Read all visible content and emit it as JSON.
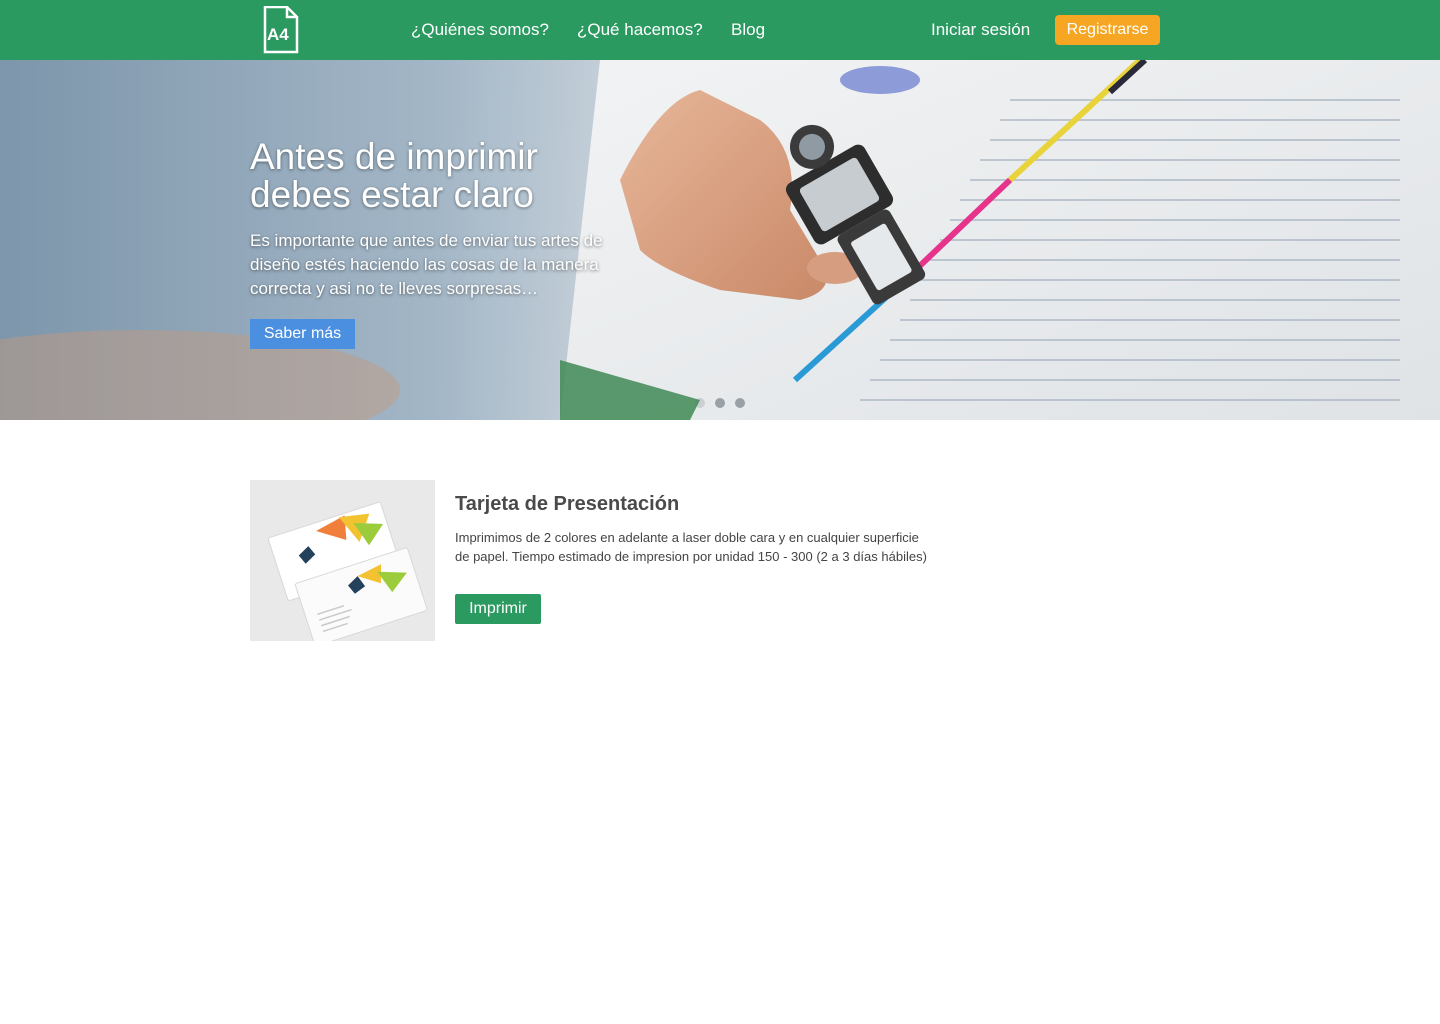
{
  "colors": {
    "nav_background": "#2b9a61",
    "register_button": "#f6a623",
    "hero_button": "#4a8fe0",
    "print_button": "#2b9a61"
  },
  "header": {
    "logo_text": "A4",
    "nav": {
      "quienes": "¿Quiénes somos?",
      "que_hacemos": "¿Qué hacemos?",
      "blog": "Blog"
    },
    "login_label": "Iniciar sesión",
    "register_label": "Registrarse"
  },
  "hero": {
    "title_line1": "Antes de imprimir",
    "title_line2": "debes estar claro",
    "subtitle": "Es importante que antes de enviar tus artes de diseño estés haciendo las cosas de la manera correcta y asi no te lleves sorpresas…",
    "button_label": "Saber más",
    "slides_count": 3,
    "active_slide": 1
  },
  "product": {
    "title": "Tarjeta de Presentación",
    "description": "Imprimimos de 2 colores en adelante a laser doble cara y en cualquier superficie de papel. Tiempo estimado de impresion por unidad 150 - 300 (2 a 3 días hábiles)",
    "button_label": "Imprimir"
  }
}
